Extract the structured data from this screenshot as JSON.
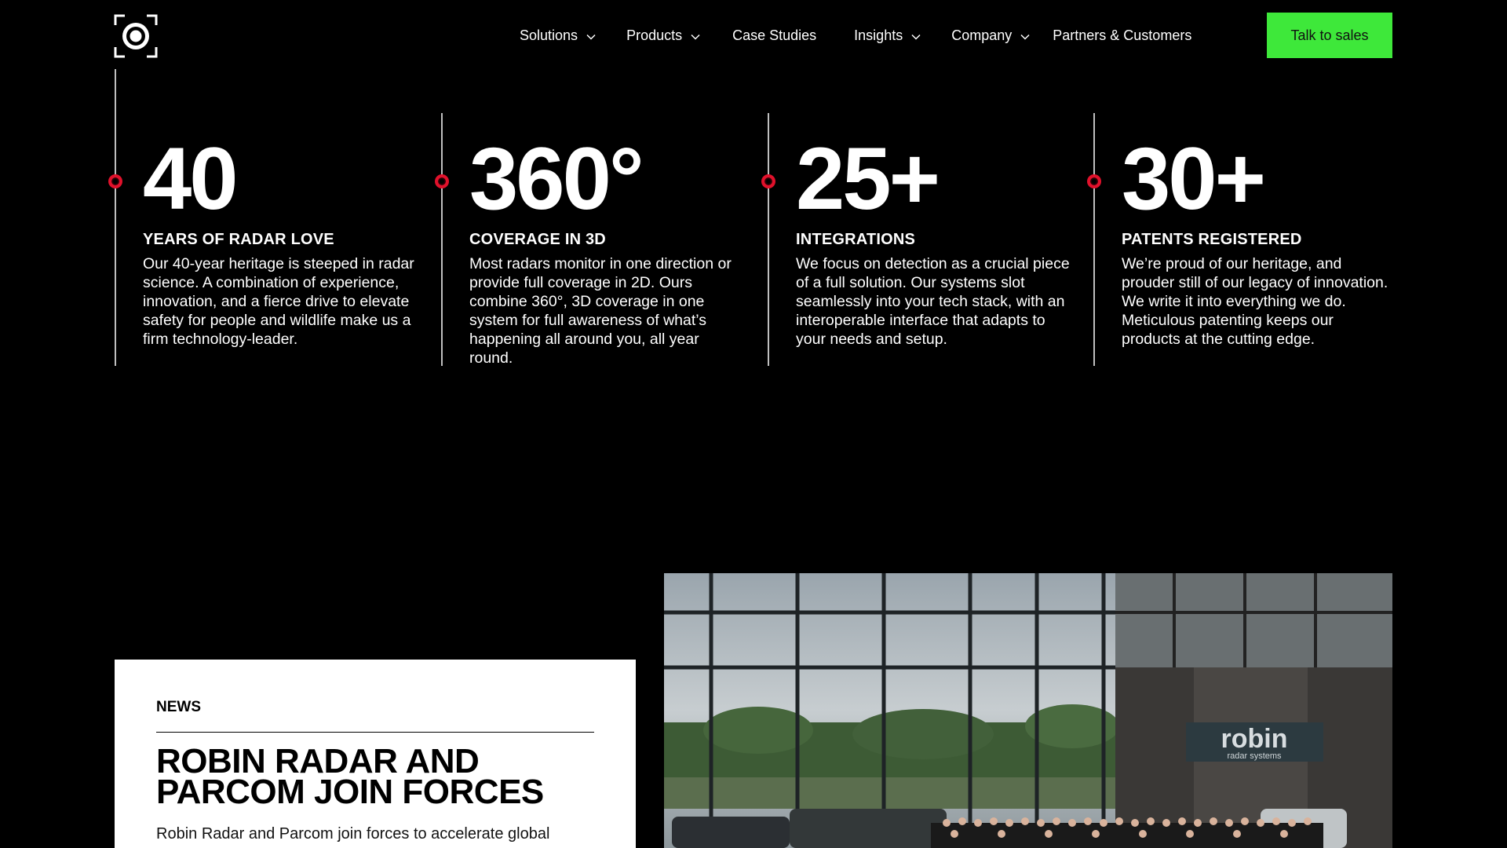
{
  "header": {
    "logo_name": "radar-logo",
    "nav": [
      {
        "label": "Solutions",
        "has_dropdown": true
      },
      {
        "label": "Products",
        "has_dropdown": true
      },
      {
        "label": "Case Studies",
        "has_dropdown": false
      },
      {
        "label": "Insights",
        "has_dropdown": true
      },
      {
        "label": "Company",
        "has_dropdown": true
      },
      {
        "label": "Partners & Customers",
        "has_dropdown": false
      }
    ],
    "cta_label": "Talk to sales"
  },
  "stats": [
    {
      "number": "40",
      "title": "YEARS OF RADAR LOVE",
      "description": "Our 40-year heritage is steeped in radar science. A combination of experience, innovation, and a fierce drive to elevate safety for people and wildlife make us a firm technology-leader."
    },
    {
      "number": "360°",
      "title": "COVERAGE IN 3D",
      "description": "Most radars monitor in one direction or provide full coverage in 2D. Ours combine 360°, 3D coverage in one system for full awareness of what’s happening all around you, all year round."
    },
    {
      "number": "25+",
      "title": "INTEGRATIONS",
      "description": "We focus on detection as a crucial piece of a full solution. Our systems slot seamlessly into your tech stack, with an interoperable interface that adapts to your needs and setup."
    },
    {
      "number": "30+",
      "title": "PATENTS REGISTERED",
      "description": "We’re proud of our heritage, and prouder still of our legacy of innovation. We write it into everything we do. Meticulous patenting keeps our products at the cutting edge."
    }
  ],
  "news": {
    "label": "NEWS",
    "title": "ROBIN RADAR AND PARCOM JOIN FORCES",
    "description": "Robin Radar and Parcom join forces to accelerate global"
  },
  "photo": {
    "sign_main": "robin",
    "sign_sub": "radar systems"
  },
  "colors": {
    "accent_green": "#3ee83a",
    "dot_red": "#e0112b",
    "background": "#000000"
  }
}
